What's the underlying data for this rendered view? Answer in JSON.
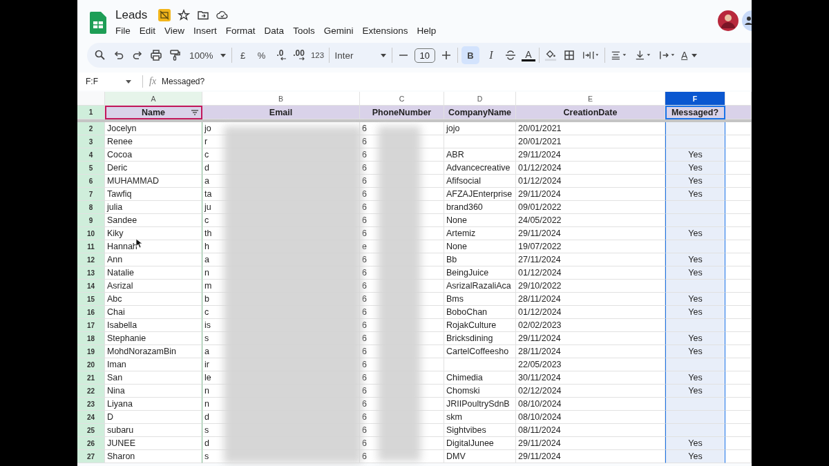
{
  "document": {
    "title": "Leads"
  },
  "menu": [
    "File",
    "Edit",
    "View",
    "Insert",
    "Format",
    "Data",
    "Tools",
    "Gemini",
    "Extensions",
    "Help"
  ],
  "toolbar": {
    "zoom": "100%",
    "currency": "£",
    "percent": "%",
    "decrease_decimals": ".0",
    "increase_decimals": ".00",
    "number_format": "123",
    "font": "Inter",
    "font_size": "10",
    "bold": {
      "label": "B",
      "selected": true
    },
    "italic": {
      "label": "I",
      "selected": false
    },
    "text_color": "A",
    "text_rotation": "A"
  },
  "formula_bar": {
    "name_box": "F:F",
    "fx": "fx",
    "formula": "Messaged?"
  },
  "columns": [
    {
      "letter": "A",
      "selected": false,
      "peer_selected": true
    },
    {
      "letter": "B",
      "selected": false,
      "peer_selected": false
    },
    {
      "letter": "C",
      "selected": false,
      "peer_selected": false
    },
    {
      "letter": "D",
      "selected": false,
      "peer_selected": false
    },
    {
      "letter": "E",
      "selected": false,
      "peer_selected": false
    },
    {
      "letter": "F",
      "selected": true,
      "peer_selected": false
    }
  ],
  "header_row": {
    "number": "1",
    "cells": [
      "Name",
      "Email",
      "PhoneNumber",
      "CompanyName",
      "CreationDate",
      "Messaged?"
    ]
  },
  "rows": [
    {
      "number": "2",
      "name": "Jocelyn",
      "email": "jo",
      "phone": "6",
      "company": "jojo",
      "date": "20/01/2021"
    },
    {
      "number": "3",
      "name": "Renee",
      "email": "r",
      "phone": "6",
      "date": "20/01/2021"
    },
    {
      "number": "4",
      "name": "Cocoa",
      "email": "c",
      "phone": "6",
      "company": "ABR",
      "date": "29/11/2024",
      "messaged": "Yes"
    },
    {
      "number": "5",
      "name": "Deric",
      "email": "d",
      "phone": "6",
      "company": "Advancecreative",
      "date": "01/12/2024",
      "messaged": "Yes"
    },
    {
      "number": "6",
      "name": "MUHAMMAD",
      "email": "a",
      "phone": "6",
      "company": "Afifsocial",
      "date": "01/12/2024",
      "messaged": "Yes"
    },
    {
      "number": "7",
      "name": "Tawfiq",
      "email": "ta",
      "phone": "6",
      "company": "AFZAJEnterprise",
      "date": "29/11/2024",
      "messaged": "Yes"
    },
    {
      "number": "8",
      "name": "julia",
      "email": "ju",
      "phone": "6",
      "company": "brand360",
      "date": "09/01/2022"
    },
    {
      "number": "9",
      "name": "Sandee",
      "email": "c",
      "phone": "6",
      "company": "None",
      "date": "24/05/2022"
    },
    {
      "number": "10",
      "name": "Kiky",
      "email": "th",
      "phone": "6",
      "company": "Artemiz",
      "date": "29/11/2024",
      "messaged": "Yes"
    },
    {
      "number": "11",
      "name": "Hannah",
      "email": "h",
      "phone": "e",
      "company": "None",
      "date": "19/07/2022"
    },
    {
      "number": "12",
      "name": "Ann",
      "email": "a",
      "phone": "6",
      "company": "Bb",
      "date": "27/11/2024",
      "messaged": "Yes"
    },
    {
      "number": "13",
      "name": "Natalie",
      "email": "n",
      "phone": "6",
      "company": "BeingJuice",
      "date": "01/12/2024",
      "messaged": "Yes"
    },
    {
      "number": "14",
      "name": "Asrizal",
      "email": "m",
      "phone": "6",
      "company": "AsrizalRazaliAca",
      "date": "29/10/2022"
    },
    {
      "number": "15",
      "name": "Abc",
      "email": "b",
      "phone": "6",
      "company": "Bms",
      "date": "28/11/2024",
      "messaged": "Yes"
    },
    {
      "number": "16",
      "name": "Chai",
      "email": "c",
      "phone": "6",
      "company": "BoboChan",
      "date": "01/12/2024",
      "messaged": "Yes"
    },
    {
      "number": "17",
      "name": "Isabella",
      "email": "is",
      "phone": "6",
      "company": "RojakCulture",
      "date": "02/02/2023"
    },
    {
      "number": "18",
      "name": "Stephanie",
      "email": "s",
      "phone": "6",
      "company": "Bricksdining",
      "date": "29/11/2024",
      "messaged": "Yes"
    },
    {
      "number": "19",
      "name": "MohdNorazamBin",
      "email": "a",
      "phone": "6",
      "company": "CartelCoffeesho",
      "date": "28/11/2024",
      "messaged": "Yes"
    },
    {
      "number": "20",
      "name": "Iman",
      "email": "ir",
      "phone": "6",
      "date": "22/05/2023"
    },
    {
      "number": "21",
      "name": "San",
      "email": "le",
      "phone": "6",
      "company": "Chimedia",
      "date": "30/11/2024",
      "messaged": "Yes"
    },
    {
      "number": "22",
      "name": "Nina",
      "email": "n",
      "phone": "6",
      "company": "Chomski",
      "date": "02/12/2024",
      "messaged": "Yes"
    },
    {
      "number": "23",
      "name": "Liyana",
      "email": "n",
      "phone": "6",
      "company": "JRIIPoultrySdnB",
      "date": "08/10/2024"
    },
    {
      "number": "24",
      "name": "D",
      "email": "d",
      "phone": "6",
      "company": "skm",
      "date": "08/10/2024"
    },
    {
      "number": "25",
      "name": "subaru",
      "email": "s",
      "phone": "6",
      "company": "Sightvibes",
      "date": "08/11/2024"
    },
    {
      "number": "26",
      "name": "JUNEE",
      "email": "d",
      "phone": "6",
      "company": "DigitalJunee",
      "date": "29/11/2024",
      "messaged": "Yes"
    },
    {
      "number": "27",
      "name": "Sharon",
      "email": "s",
      "phone": "6",
      "company": "DMV",
      "date": "29/11/2024",
      "messaged": "Yes"
    }
  ]
}
